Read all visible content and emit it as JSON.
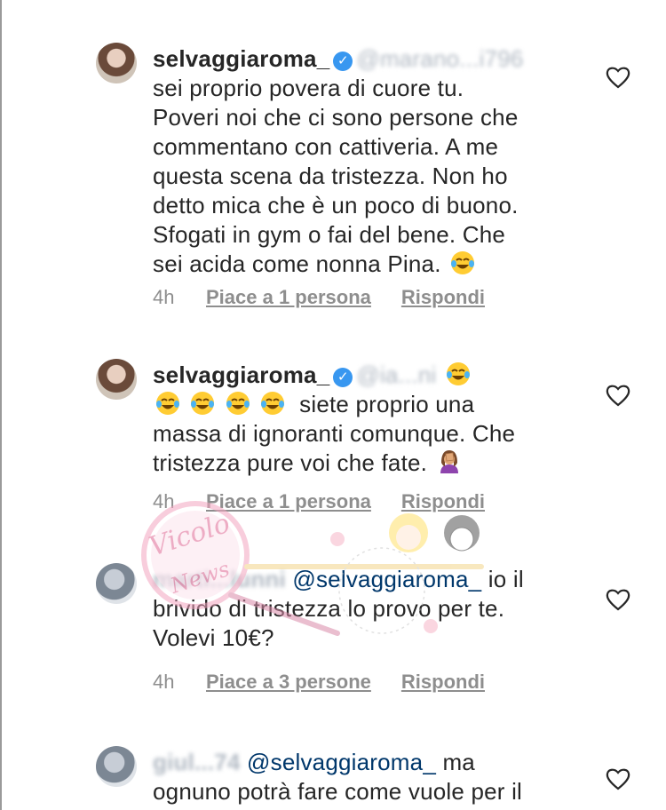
{
  "comments": [
    {
      "username": "selvaggiaroma_",
      "mention": "@marano...i796",
      "text_lines": [
        "sei proprio povera di cuore tu.",
        "Poveri noi che ci sono persone che",
        "commentano con cattiveria. A me",
        "questa scena da tristezza. Non ho",
        "detto mica che è un poco di buono.",
        "Sfogati in gym o fai del bene. Che",
        "sei acida come nonna Pina."
      ],
      "time": "4h",
      "likes": "Piace a 1 persona",
      "reply": "Rispondi"
    },
    {
      "username": "selvaggiaroma_",
      "mention": "@ia...ni",
      "text_lines": [
        "siete proprio una",
        "massa di ignoranti comunque. Che",
        "tristezza pure voi che fate."
      ],
      "time": "4h",
      "likes": "Piace a 1 persona",
      "reply": "Rispondi"
    },
    {
      "username": "marti...lunni",
      "mention": "@selvaggiaroma_",
      "text_lines": [
        "io il",
        "brivido di tristezza lo provo per te.",
        "Volevi 10€?"
      ],
      "time": "4h",
      "likes": "Piace a 3 persone",
      "reply": "Rispondi"
    },
    {
      "username": "giul...74",
      "mention": "@selvaggiaroma_",
      "text_lines": [
        "ma",
        "ognuno potrà fare come vuole per il"
      ]
    }
  ],
  "icons": {
    "verified": "verified-badge-icon",
    "like": "heart-outline-icon",
    "laugh": "face-with-tears-of-joy-emoji",
    "facepalm": "woman-facepalming-emoji"
  },
  "colors": {
    "text": "#262626",
    "meta": "#8e8e8e",
    "mention": "#00376b",
    "verified": "#3897f0"
  },
  "watermark": {
    "text": "Vicolo delle News"
  }
}
